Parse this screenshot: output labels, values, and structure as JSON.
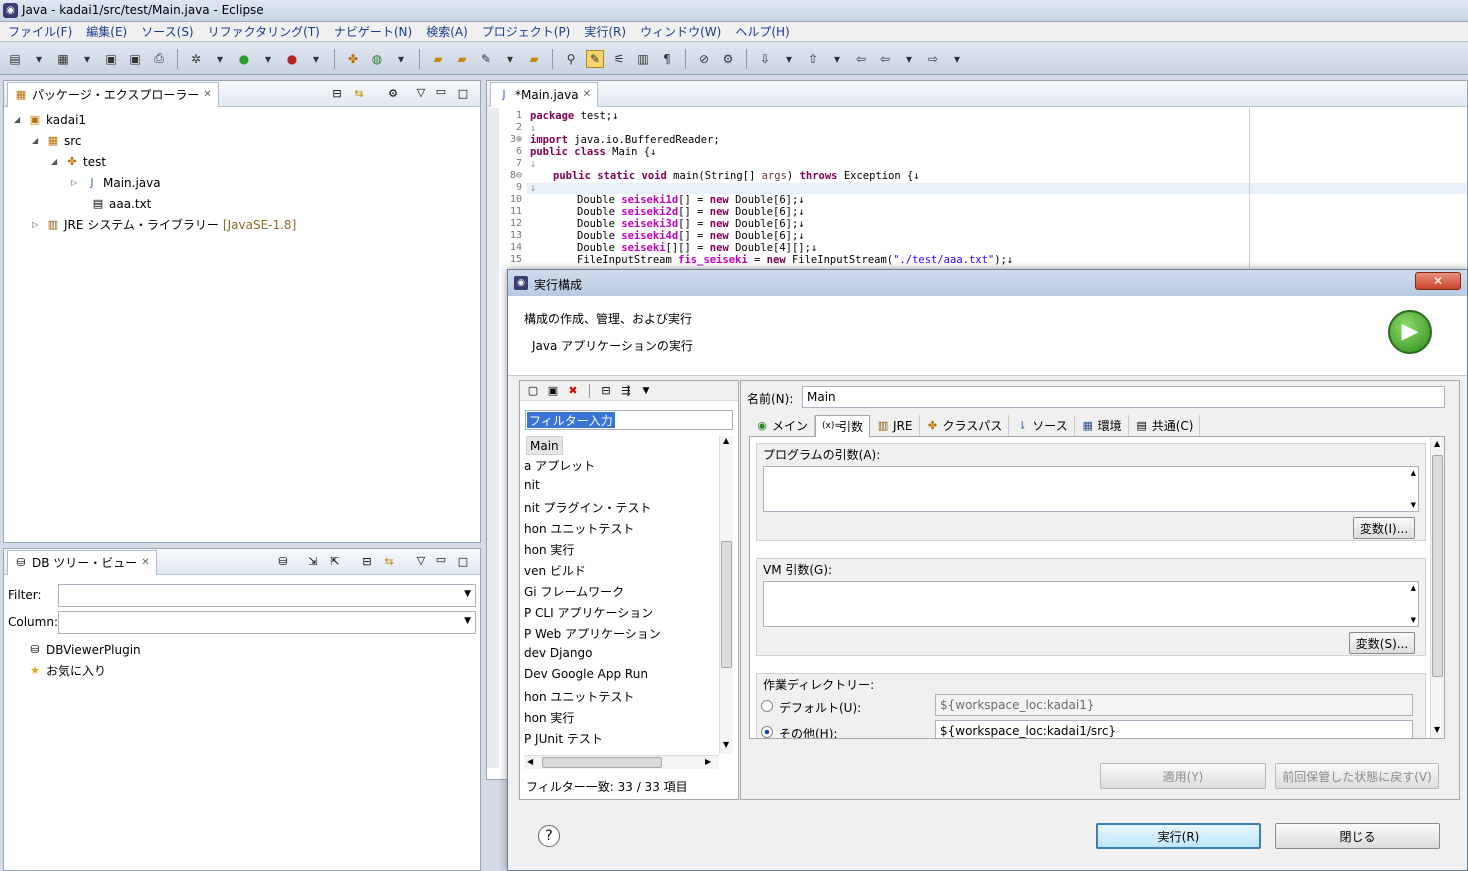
{
  "window": {
    "title": "Java - kadai1/src/test/Main.java - Eclipse"
  },
  "menu": [
    "ファイル(F)",
    "編集(E)",
    "ソース(S)",
    "リファクタリング(T)",
    "ナビゲート(N)",
    "検索(A)",
    "プロジェクト(P)",
    "実行(R)",
    "ウィンドウ(W)",
    "ヘルプ(H)"
  ],
  "package_explorer": {
    "tab": "パッケージ・エクスプローラー",
    "tree": [
      {
        "label": "kadai1",
        "extra": ""
      },
      {
        "label": "src",
        "extra": ""
      },
      {
        "label": "test",
        "extra": ""
      },
      {
        "label": "Main.java",
        "extra": ""
      },
      {
        "label": "aaa.txt",
        "extra": ""
      },
      {
        "label": "JRE システム・ライブラリー",
        "extra": "[JavaSE-1.8]"
      }
    ]
  },
  "db_view": {
    "tab": "DB ツリー・ビュー",
    "filter_label": "Filter:",
    "column_label": "Column:",
    "items": [
      "DBViewerPlugin",
      "お気に入り"
    ]
  },
  "editor": {
    "tab": "*Main.java",
    "lines": [
      {
        "n": "1",
        "html": "package"
      },
      {
        "n": "2"
      },
      {
        "n": "3"
      },
      {
        "n": "6"
      },
      {
        "n": "7"
      },
      {
        "n": "8"
      },
      {
        "n": "9"
      },
      {
        "n": "10"
      },
      {
        "n": "11"
      },
      {
        "n": "12"
      },
      {
        "n": "13"
      },
      {
        "n": "14"
      },
      {
        "n": "15"
      }
    ],
    "code": {
      "l1_kw": "package",
      "l1": " test;↓",
      "l2": "↓",
      "l3_kw": "import",
      "l3": " java.io.BufferedReader;",
      "l6_kw": "public class",
      "l6": " Main {↓",
      "l7": "↓",
      "l8_kw1": "public static void",
      "l8a": " main(String[] ",
      "l8_args": "args",
      "l8b": ") ",
      "l8_kw2": "throws",
      "l8c": " Exception {↓",
      "l9": "↓",
      "d": "Double ",
      "f1": "seiseki1d",
      "f2": "seiseki2d",
      "f3": "seiseki3d",
      "f4": "seiseki4d",
      "f5": "seiseki",
      "eq": "[] = ",
      "nw": "new",
      "r6": " Double[6];↓",
      "r4": " Double[4][];↓",
      "eq2": "[][] = ",
      "l15a": "FileInputStream ",
      "l15f": "fis_seiseki",
      "l15b": " = ",
      "l15c": " FileInputStream(",
      "l15s": "\"./test/aaa.txt\"",
      "l15d": ");↓"
    }
  },
  "dialog": {
    "title": "実行構成",
    "header": "構成の作成、管理、および実行",
    "subheader": "Java アプリケーションの実行",
    "filter_placeholder": "フィルター入力",
    "list": [
      "Main",
      "a アプレット",
      "nit",
      "nit プラグイン・テスト",
      "hon ユニットテスト",
      "hon 実行",
      "ven ビルド",
      "Gi フレームワーク",
      "P CLI アプリケーション",
      "P Web アプリケーション",
      "dev Django",
      "Dev Google App Run",
      "hon ユニットテスト",
      "hon 実行",
      "P JUnit テスト"
    ],
    "filter_status": "フィルター一致: 33 / 33 項目",
    "name_label": "名前(N):",
    "name_value": "Main",
    "tabs": [
      "メイン",
      "引数",
      "JRE",
      "クラスパス",
      "ソース",
      "環境",
      "共通(C)"
    ],
    "program_args_label": "プログラムの引数(A):",
    "vm_args_label": "VM 引数(G):",
    "variables1": "変数(I)...",
    "variables2": "変数(S)...",
    "workdir_label": "作業ディレクトリー:",
    "default_label": "デフォルト(U):",
    "default_value": "${workspace_loc:kadai1}",
    "other_label": "その他(H):",
    "other_value": "${workspace_loc:kadai1/src}",
    "apply": "適用(Y)",
    "revert": "前回保管した状態に戻す(V)",
    "run": "実行(R)",
    "close": "閉じる",
    "help": "?"
  }
}
